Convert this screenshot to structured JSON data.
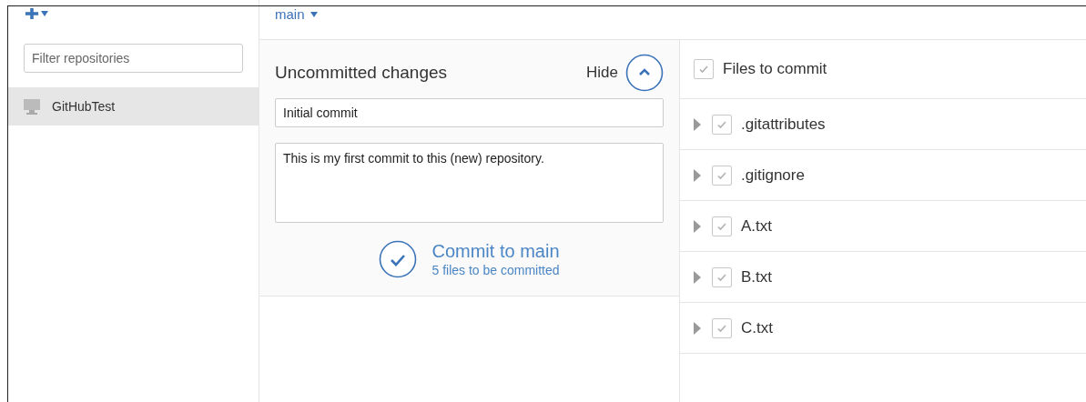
{
  "toolbar": {
    "branch": "main"
  },
  "sidebar": {
    "filter": {
      "placeholder": "Filter repositories"
    },
    "repositories": [
      {
        "name": "GitHubTest",
        "selected": true
      }
    ]
  },
  "changes": {
    "title": "Uncommitted changes",
    "hide_label": "Hide",
    "summary": "Initial commit",
    "description": "This is my first commit to this (new) repository.",
    "commit_label": "Commit to main",
    "commit_count": "5 files to be committed"
  },
  "files": {
    "header": {
      "label": "Files to commit",
      "checked": true
    },
    "items": [
      {
        "name": ".gitattributes",
        "checked": true
      },
      {
        "name": ".gitignore",
        "checked": true
      },
      {
        "name": "A.txt",
        "checked": true
      },
      {
        "name": "B.txt",
        "checked": true
      },
      {
        "name": "C.txt",
        "checked": true
      }
    ]
  }
}
